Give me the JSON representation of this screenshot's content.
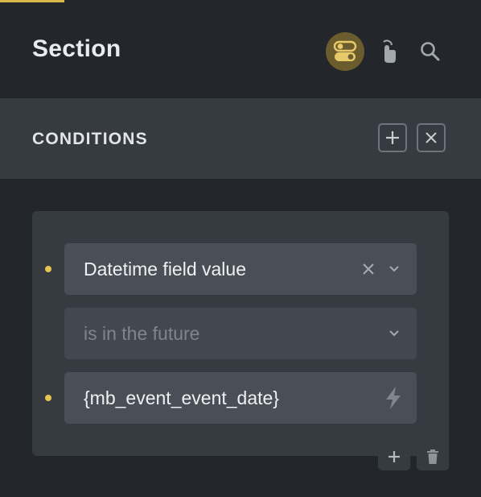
{
  "header": {
    "title": "Section",
    "icons": [
      "toggles-icon",
      "touch-icon",
      "search-icon"
    ],
    "accent_color": "#d6b84a"
  },
  "conditions": {
    "title": "CONDITIONS",
    "add_icon": "plus-icon",
    "close_icon": "close-icon"
  },
  "condition": {
    "field_value": "Datetime field value",
    "operator_placeholder": "is in the future",
    "value": "{mb_event_event_date}",
    "dot_color": "#e5c451"
  },
  "footer": {
    "add_icon": "plus-icon",
    "delete_icon": "trash-icon"
  }
}
